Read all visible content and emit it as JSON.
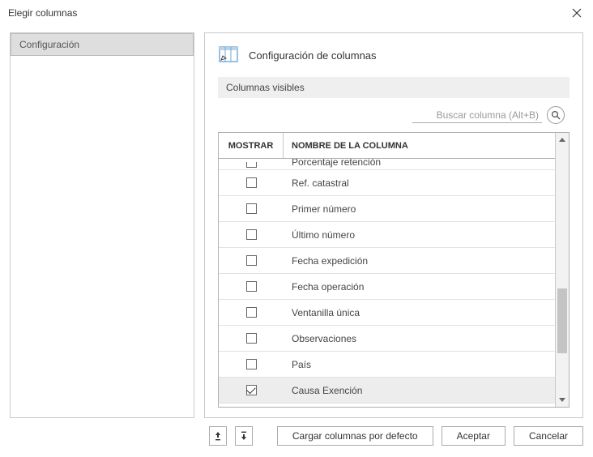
{
  "window": {
    "title": "Elegir columnas"
  },
  "sidebar": {
    "items": [
      {
        "label": "Configuración"
      }
    ]
  },
  "panel": {
    "title": "Configuración de columnas",
    "subheader": "Columnas visibles"
  },
  "search": {
    "placeholder": "Buscar columna (Alt+B)"
  },
  "table": {
    "headers": {
      "show": "MOSTRAR",
      "name": "NOMBRE DE LA COLUMNA"
    },
    "rows": [
      {
        "name": "Porcentaje retención",
        "checked": false,
        "clipped": true
      },
      {
        "name": "Ref. catastral",
        "checked": false
      },
      {
        "name": "Primer número",
        "checked": false
      },
      {
        "name": "Último número",
        "checked": false
      },
      {
        "name": "Fecha expedición",
        "checked": false
      },
      {
        "name": "Fecha operación",
        "checked": false
      },
      {
        "name": "Ventanilla única",
        "checked": false
      },
      {
        "name": "Observaciones",
        "checked": false
      },
      {
        "name": "País",
        "checked": false
      },
      {
        "name": "Causa Exención",
        "checked": true,
        "selected": true
      }
    ]
  },
  "footer": {
    "load_defaults": "Cargar columnas por defecto",
    "accept": "Aceptar",
    "cancel": "Cancelar"
  }
}
